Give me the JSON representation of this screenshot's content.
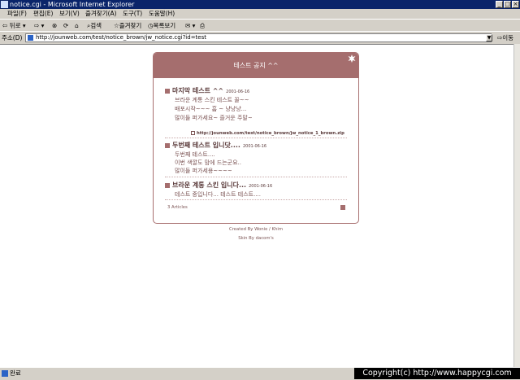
{
  "window": {
    "title": "notice.cgi - Microsoft Internet Explorer",
    "controls": [
      "_",
      "□",
      "×"
    ]
  },
  "menu": [
    "파일(F)",
    "편집(E)",
    "보기(V)",
    "즐겨찾기(A)",
    "도구(T)",
    "도움말(H)"
  ],
  "toolbar": {
    "back": "뒤로",
    "search": "검색",
    "favorites": "즐겨찾기",
    "history": "목록보기"
  },
  "address": {
    "label": "주소(D)",
    "url": "http://jounweb.com/test/notice_brown/jw_notice.cgi?id=test",
    "go": "이동"
  },
  "board": {
    "title": "테스트 공지 ^^",
    "entries": [
      {
        "title": "마지막 테스트 ^^",
        "date": "2001-06-16",
        "lines": [
          "브라운 계통 스킨 테스트 꼴~~",
          "배포시작~~~ 흠 ~ 냥냥냥...",
          "많이들 퍼가세요~ 즐거운 주말~"
        ],
        "link": "http://jounweb.com/test/notice_brown/jw_notice_1_brown.zip"
      },
      {
        "title": "두번째 테스트 입니닷....",
        "date": "2001-06-16",
        "lines": [
          "두번째 테스트....",
          "이번 색깔도 맘에 드는군요..",
          "많이들 퍼가세용~~~~"
        ]
      },
      {
        "title": "브라운 계통 스킨 입니다...",
        "date": "2001-06-16",
        "lines": [
          "테스트 중입니다... 테스트 테스트...."
        ]
      }
    ],
    "count": "3 Articles"
  },
  "footer": {
    "created": "Created By Wonie / Khim",
    "skin": "Skin By dacom's"
  },
  "status": {
    "text": "완료"
  },
  "copyright": "Copyright(c) http://www.happycgi.com"
}
